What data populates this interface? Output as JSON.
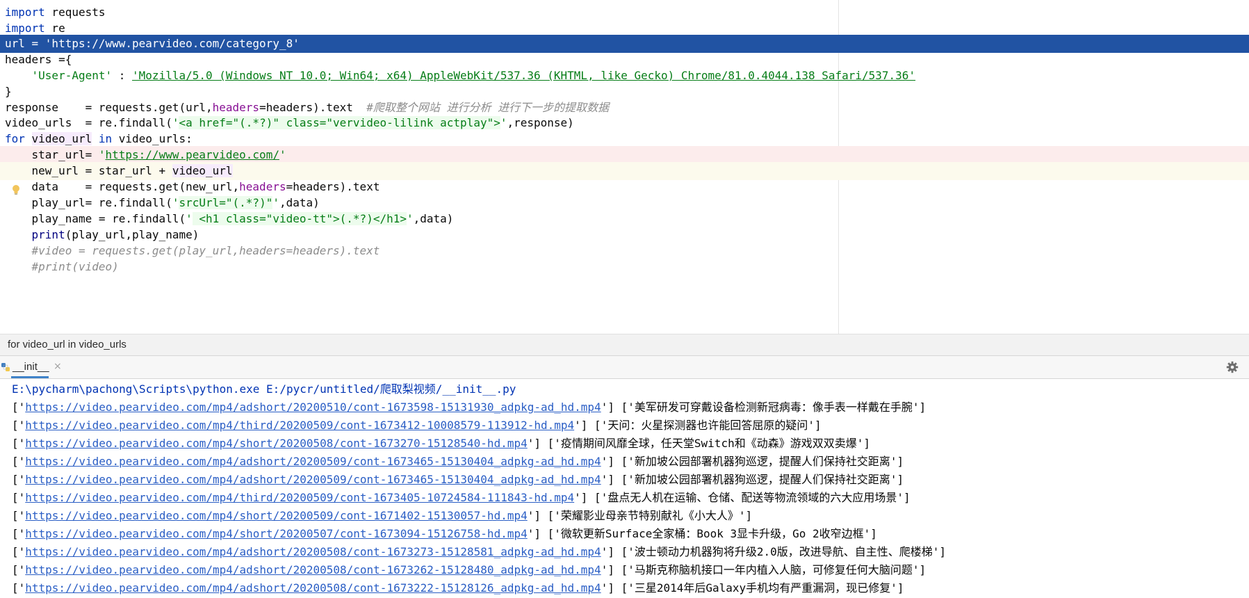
{
  "editor": {
    "lines": {
      "l1": {
        "kw": "import",
        "rest": " requests"
      },
      "l2": {
        "kw": "import",
        "rest": " re"
      },
      "l3": {
        "pre": "url = ",
        "str": "'https://www.pearvideo.com/category_8'"
      },
      "l4": {
        "text": "headers ={"
      },
      "l5": {
        "indent": "    ",
        "key": "'User-Agent'",
        "sep": " : ",
        "value": "'Mozilla/5.0 (Windows NT 10.0; Win64; x64) AppleWebKit/537.36 (KHTML, like Gecko) Chrome/81.0.4044.138 Safari/537.36'"
      },
      "l6": {
        "text": "}"
      },
      "l7": {
        "pre": "response    = requests.get(url,",
        "param": "headers",
        "post": "=headers).text  ",
        "comment": "#爬取整个网站 进行分析 进行下一步的提取数据"
      },
      "l8": {
        "pre": "video_urls  = re.findall(",
        "q1": "'",
        "rx": "<a href=\"(.*?)\" class=\"vervideo-lilink actplay\">",
        "q2": "'",
        "post": ",response)"
      },
      "l9": {
        "kw1": "for",
        "sp1": " ",
        "var": "video_url",
        "sp2": " ",
        "kw2": "in",
        "rest": " video_urls:"
      },
      "l10": {
        "pre": "    star_url= ",
        "q1": "'",
        "url": "https://www.pearvideo.com/",
        "q2": "'"
      },
      "l11": {
        "pre": "    new_url = star_url + ",
        "var": "video_url"
      },
      "l12": {
        "pre": "    data    = requests.get(new_url,",
        "param": "headers",
        "post": "=headers).text"
      },
      "l13": {
        "pre": "    play_url= re.findall(",
        "q1": "'",
        "rx": "srcUrl=\"(.*?)\"",
        "q2": "'",
        "post": ",data)"
      },
      "l14": {
        "pre": "    play_name = re.findall(",
        "q1": "'",
        "rx": " <h1 class=\"video-tt\">(.*?)</h1>",
        "q2": "'",
        "post": ",data)"
      },
      "l15": {
        "indent": "    ",
        "fn": "print",
        "rest": "(play_url,play_name)"
      },
      "l16": {
        "indent": "    ",
        "comment": "#video = requests.get(play_url,headers=headers).text"
      },
      "l17": {
        "indent": "    ",
        "comment": "#print(video)"
      }
    }
  },
  "breadcrumb": {
    "text": "for video_url in video_urls"
  },
  "run_tab": {
    "label": "__init__",
    "close": "×"
  },
  "console": {
    "command": "E:\\pycharm\\pachong\\Scripts\\python.exe E:/pycr/untitled/爬取梨视频/__init__.py",
    "rows": [
      {
        "url": "https://video.pearvideo.com/mp4/adshort/20200510/cont-1673598-15131930_adpkg-ad_hd.mp4",
        "title": "美军研发可穿戴设备检测新冠病毒：像手表一样戴在手腕"
      },
      {
        "url": "https://video.pearvideo.com/mp4/third/20200509/cont-1673412-10008579-113912-hd.mp4",
        "title": "天问：火星探测器也许能回答屈原的疑问"
      },
      {
        "url": "https://video.pearvideo.com/mp4/short/20200508/cont-1673270-15128540-hd.mp4",
        "title": "疫情期间风靡全球，任天堂Switch和《动森》游戏双双卖爆"
      },
      {
        "url": "https://video.pearvideo.com/mp4/adshort/20200509/cont-1673465-15130404_adpkg-ad_hd.mp4",
        "title": "新加坡公园部署机器狗巡逻，提醒人们保持社交距离"
      },
      {
        "url": "https://video.pearvideo.com/mp4/adshort/20200509/cont-1673465-15130404_adpkg-ad_hd.mp4",
        "title": "新加坡公园部署机器狗巡逻，提醒人们保持社交距离"
      },
      {
        "url": "https://video.pearvideo.com/mp4/third/20200509/cont-1673405-10724584-111843-hd.mp4",
        "title": "盘点无人机在运输、仓储、配送等物流领域的六大应用场景"
      },
      {
        "url": "https://video.pearvideo.com/mp4/short/20200509/cont-1671402-15130057-hd.mp4",
        "title": "荣耀影业母亲节特别献礼《小大人》"
      },
      {
        "url": "https://video.pearvideo.com/mp4/short/20200507/cont-1673094-15126758-hd.mp4",
        "title": "微软更新Surface全家桶：Book 3显卡升级，Go 2收窄边框"
      },
      {
        "url": "https://video.pearvideo.com/mp4/adshort/20200508/cont-1673273-15128581_adpkg-ad_hd.mp4",
        "title": "波士顿动力机器狗将升级2.0版，改进导航、自主性、爬楼梯"
      },
      {
        "url": "https://video.pearvideo.com/mp4/adshort/20200508/cont-1673262-15128480_adpkg-ad_hd.mp4",
        "title": "马斯克称脑机接口一年内植入人脑，可修复任何大脑问题"
      },
      {
        "url": "https://video.pearvideo.com/mp4/adshort/20200508/cont-1673222-15128126_adpkg-ad_hd.mp4",
        "title": "三星2014年后Galaxy手机均有严重漏洞，现已修复"
      }
    ],
    "row_prefix": "['",
    "row_mid": "'] ['",
    "row_suffix": "']"
  },
  "colors": {
    "selection": "#2153a3",
    "keyword": "#0033b3",
    "string": "#067d17",
    "link": "#2a5ec5"
  },
  "icons": {
    "bulb": "lightbulb-icon",
    "gear": "gear-icon",
    "python": "python-file-icon",
    "close": "close-icon"
  }
}
